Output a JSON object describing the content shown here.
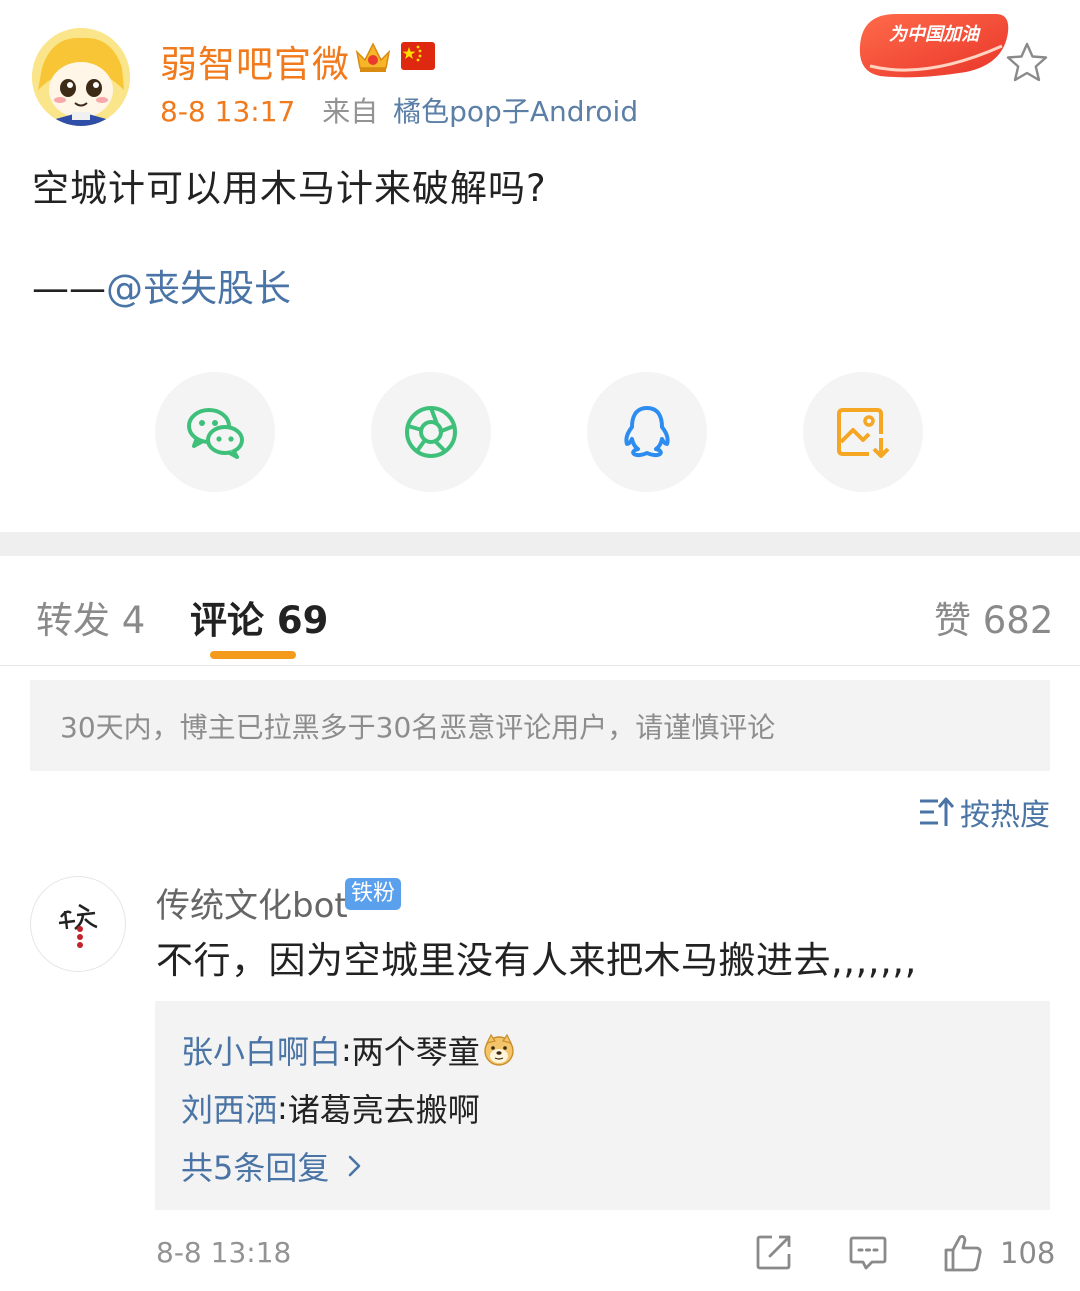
{
  "post": {
    "author": "弱智吧官微",
    "time": "8-8 13:17",
    "source_prefix": "来自",
    "source_device": "橘色pop子Android",
    "badge_text": "为中国加油",
    "content": "空城计可以用木马计来破解吗?",
    "sign_prefix": "——",
    "sign_mention": "@丧失股长",
    "icons": [
      "avatar",
      "crown-icon",
      "china-flag-icon",
      "star-icon"
    ]
  },
  "share": {
    "buttons": [
      {
        "name": "wechat",
        "icon": "wechat-icon",
        "color": "#3fc07a"
      },
      {
        "name": "moments",
        "icon": "moments-icon",
        "color": "#3fc07a"
      },
      {
        "name": "qq",
        "icon": "qq-icon",
        "color": "#2c8cf0"
      },
      {
        "name": "save-image",
        "icon": "save-image-icon",
        "color": "#f5a623"
      }
    ]
  },
  "tabs": {
    "repost": "转发 4",
    "comments": "评论 69",
    "likes": "赞 682",
    "active": "comments"
  },
  "notice": "30天内，博主已拉黑多于30名恶意评论用户，请谨慎评论",
  "sort_label": "按热度",
  "comment": {
    "user": "传统文化bot",
    "badge": "铁粉",
    "text": "不行，因为空城里没有人来把木马搬进去,,,,,,,",
    "replies": [
      {
        "name": "张小白啊白",
        "sep": ": ",
        "text": "两个琴童"
      },
      {
        "name": "刘西洒",
        "sep": ": ",
        "text": "诸葛亮去搬啊"
      }
    ],
    "more_replies": "共5条回复",
    "time": "8-8 13:18",
    "likes": "108"
  },
  "colors": {
    "accent_orange": "#f07a1c",
    "link_blue": "#4a74a5",
    "tab_underline": "#f59b1c"
  }
}
